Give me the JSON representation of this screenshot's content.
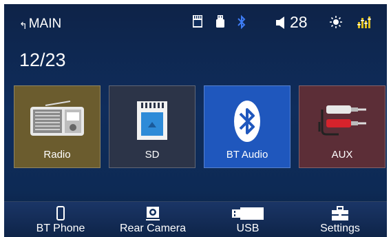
{
  "header": {
    "title": "MAIN",
    "volume": "28",
    "icons": [
      "back-arrow-icon",
      "sd-card-icon",
      "usb-icon",
      "bluetooth-icon",
      "volume-icon",
      "brightness-icon",
      "equalizer-icon"
    ]
  },
  "date": "12/23",
  "tiles": [
    {
      "label": "Radio",
      "icon": "radio-icon",
      "color": "#6b5c2e"
    },
    {
      "label": "SD",
      "icon": "sd-card-icon",
      "color": "#2c3448"
    },
    {
      "label": "BT Audio",
      "icon": "bluetooth-icon",
      "color": "#1f57bd"
    },
    {
      "label": "AUX",
      "icon": "rca-cable-icon",
      "color": "#5c2e37"
    }
  ],
  "bottom_nav": [
    {
      "label": "BT Phone",
      "icon": "phone-icon"
    },
    {
      "label": "Rear Camera",
      "icon": "camera-icon"
    },
    {
      "label": "USB",
      "icon": "usb-drive-icon"
    },
    {
      "label": "Settings",
      "icon": "toolbox-icon"
    }
  ],
  "colors": {
    "accent": "#1f57bd",
    "equalizer": "#e0c020",
    "bluetooth": "#3d7cf5"
  }
}
